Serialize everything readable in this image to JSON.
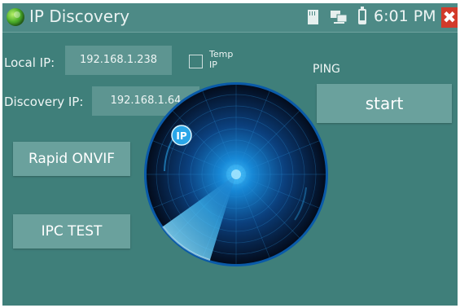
{
  "titlebar": {
    "title": "IP Discovery",
    "time": "6:01 PM",
    "close_glyph": "✖",
    "icons": [
      "app-globe-icon",
      "sd-card-icon",
      "network-icon",
      "battery-icon"
    ]
  },
  "local_ip": {
    "label": "Local IP:",
    "value": "192.168.1.238"
  },
  "temp_ip": {
    "label": "Temp IP",
    "checked": false
  },
  "discovery_ip": {
    "label": "Discovery IP:",
    "value": "192.168.1.64"
  },
  "ping": {
    "label": "PING",
    "start_label": "start"
  },
  "buttons": {
    "rapid_onvif": "Rapid ONVIF",
    "ipc_test": "IPC TEST"
  },
  "radar": {
    "badge": "IP"
  },
  "colors": {
    "background": "#3f7f7a",
    "button": "#6aa19d",
    "close": "#d23a2a",
    "radar_blue": "#1a8fe0"
  }
}
